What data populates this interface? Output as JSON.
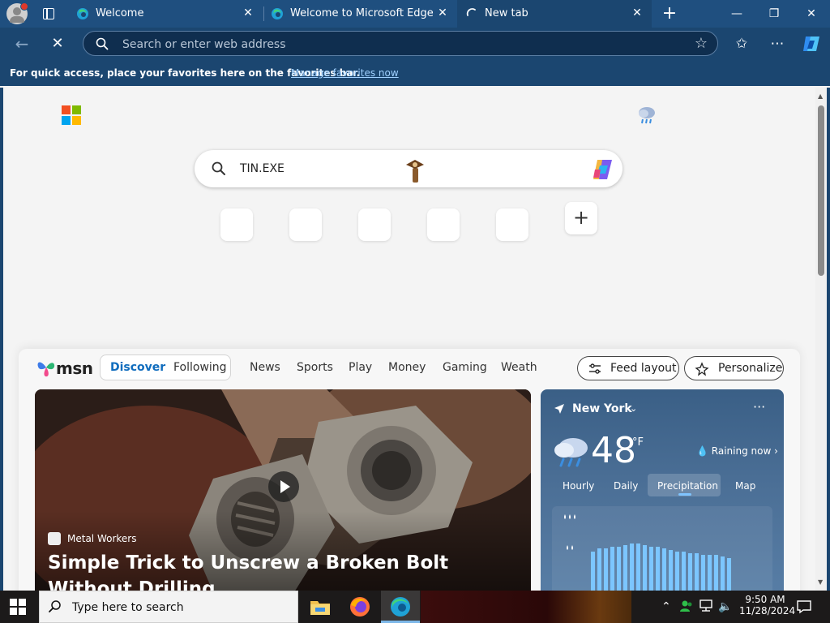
{
  "browser": {
    "tabs": [
      {
        "title": "Welcome",
        "active": false
      },
      {
        "title": "Welcome to Microsoft Edge",
        "active": false
      },
      {
        "title": "New tab",
        "active": true
      }
    ],
    "close_glyph": "✕",
    "new_tab_glyph": "+",
    "window_controls": {
      "minimize": "—",
      "maximize": "❐",
      "close": "✕"
    },
    "address_placeholder": "Search or enter web address",
    "favorites_message": "For quick access, place your favorites here on the favorites bar.",
    "favorites_link": "Manage favorites now"
  },
  "newtab": {
    "search_query": "TIN.EXE"
  },
  "msn": {
    "logo_text": "msn",
    "pill": {
      "discover": "Discover",
      "following": "Following"
    },
    "nav": [
      "News",
      "Sports",
      "Play",
      "Money",
      "Gaming",
      "Weathe"
    ],
    "feed_layout": "Feed layout",
    "personalize": "Personalize",
    "hero": {
      "source": "Metal Workers",
      "headline": "Simple Trick to Unscrew a Broken Bolt Without Drilling"
    },
    "weather": {
      "city": "New York",
      "temp": "48",
      "unit": "°F",
      "condition": "Raining now",
      "tabs": [
        "Hourly",
        "Daily",
        "Precipitation",
        "Map"
      ],
      "active_tab": "Precipitation",
      "precip_bars": [
        0.6,
        0.64,
        0.64,
        0.66,
        0.66,
        0.68,
        0.7,
        0.7,
        0.68,
        0.66,
        0.66,
        0.64,
        0.62,
        0.6,
        0.6,
        0.58,
        0.58,
        0.56,
        0.56,
        0.56,
        0.54,
        0.52,
        0.05,
        0.05,
        0.05,
        0.05
      ]
    }
  },
  "taskbar": {
    "search_placeholder": "Type here to search",
    "time": "9:50 AM",
    "date": "11/28/2024"
  },
  "colors": {
    "chrome": "#1b4670",
    "accent": "#0f6cbd",
    "taskbar": "#1c1a1a"
  }
}
